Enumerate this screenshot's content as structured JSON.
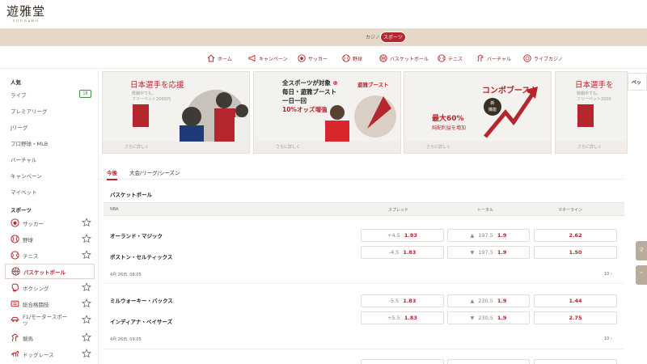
{
  "brand": {
    "name": "遊雅堂",
    "sub": "YUUGADO"
  },
  "mode": {
    "casino": "カジノ",
    "sports": "スポーツ"
  },
  "nav": [
    {
      "label": "ホーム",
      "icon": "home-icon"
    },
    {
      "label": "キャンペーン",
      "icon": "megaphone-icon"
    },
    {
      "label": "サッカー",
      "icon": "soccer-icon"
    },
    {
      "label": "野球",
      "icon": "baseball-icon"
    },
    {
      "label": "バスケットボール",
      "icon": "basketball-icon"
    },
    {
      "label": "テニス",
      "icon": "tennis-icon"
    },
    {
      "label": "バーチャル",
      "icon": "horse-icon"
    },
    {
      "label": "ライブカジノ",
      "icon": "chip-icon"
    }
  ],
  "sidebar": {
    "popular_heading": "人気",
    "popular": [
      {
        "label": "ライブ",
        "badge": "18"
      },
      {
        "label": "プレミアリーグ"
      },
      {
        "label": "Jリーグ"
      },
      {
        "label": "プロ野球・MLB"
      },
      {
        "label": "バーチャル"
      },
      {
        "label": "キャンペーン"
      },
      {
        "label": "マイベット"
      }
    ],
    "sports_heading": "スポーツ",
    "sports": [
      {
        "label": "サッカー",
        "icon": "soccer-icon"
      },
      {
        "label": "野球",
        "icon": "baseball-icon"
      },
      {
        "label": "テニス",
        "icon": "tennis-icon"
      },
      {
        "label": "バスケットボール",
        "icon": "basketball-icon",
        "active": true
      },
      {
        "label": "ボクシング",
        "icon": "boxing-glove-icon"
      },
      {
        "label": "総合格闘技",
        "icon": "fighting-icon"
      },
      {
        "label": "F1/モータースポーツ",
        "icon": "racing-icon"
      },
      {
        "label": "競馬",
        "icon": "horse-icon"
      },
      {
        "label": "ドッグレース",
        "icon": "dog-icon"
      }
    ]
  },
  "banners": [
    {
      "title": "日本選手を応援",
      "sub1": "敗戦中でも、",
      "sub2": "フリーベット2000円",
      "more": "さらに詳しく"
    },
    {
      "line1": "全スポーツが対象",
      "line2": "毎日・遊雅ブースト",
      "line3": "一日一回",
      "line4": "10%オッズ増強",
      "boost": "遊雅ブースト",
      "more": "さらに詳しく"
    },
    {
      "title": "コンボブースト",
      "pct": "最大60%",
      "sub": "純配利益を増加",
      "new_badge": "新",
      "new_badge2": "機能",
      "more": "さらに詳しく"
    },
    {
      "title": "日本選手を",
      "sub1": "敗戦中でも、",
      "sub2": "フリーベット2000",
      "more": "さらに詳しく"
    }
  ],
  "right_panel": {
    "title": "ベッ"
  },
  "tabs": [
    "今後",
    "大会/リーグ/シーズン"
  ],
  "section": {
    "title": "バスケットボール"
  },
  "table": {
    "league": "NBA",
    "col_spread": "スプレッド",
    "col_total": "トータル",
    "col_moneyline": "マネーライン"
  },
  "matches": [
    {
      "home": "オーランド・マジック",
      "away": "ボストン・セルティックス",
      "spread": [
        {
          "line": "+4.5",
          "price": "1.83"
        },
        {
          "line": "-4.5",
          "price": "1.83"
        }
      ],
      "total": [
        {
          "dir": "▲",
          "line": "197.5",
          "price": "1.9"
        },
        {
          "dir": "▼",
          "line": "197.5",
          "price": "1.9"
        }
      ],
      "moneyline": [
        "2.62",
        "1.50"
      ],
      "date": "4月 26日, 08:05",
      "more": "10"
    },
    {
      "home": "ミルウォーキー・バックス",
      "away": "インディアナ・ペイサーズ",
      "spread": [
        {
          "line": "-5.5",
          "price": "1.83"
        },
        {
          "line": "+5.5",
          "price": "1.83"
        }
      ],
      "total": [
        {
          "dir": "▲",
          "line": "230.5",
          "price": "1.9"
        },
        {
          "dir": "▼",
          "line": "230.5",
          "price": "1.9"
        }
      ],
      "moneyline": [
        "1.44",
        "2.75"
      ],
      "date": "4月 26日, 09:05",
      "more": "10"
    }
  ],
  "float_buttons": [
    "マ",
    "^"
  ]
}
